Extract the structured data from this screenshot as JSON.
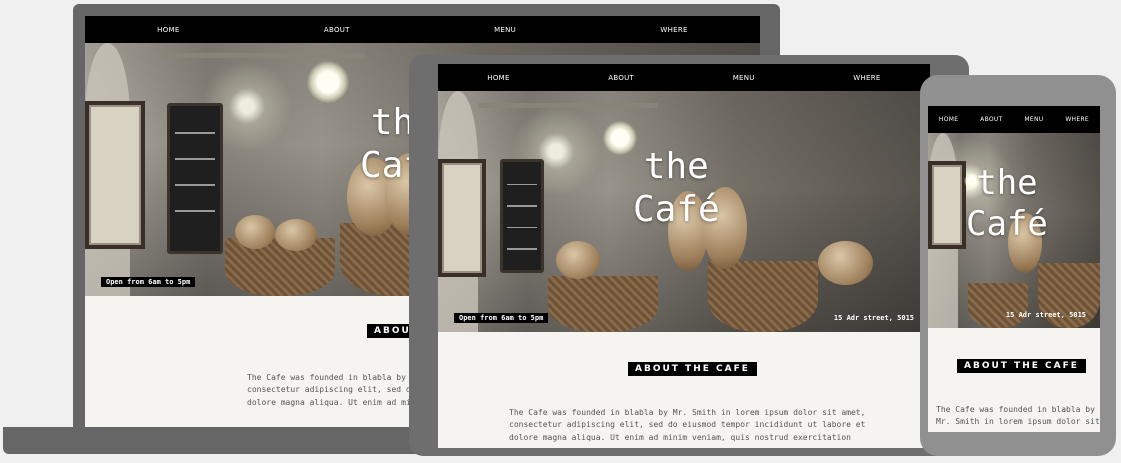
{
  "nav": {
    "home": "HOME",
    "about": "ABOUT",
    "menu": "MENU",
    "where": "WHERE"
  },
  "hero": {
    "title": "the\nCafé",
    "hours": "Open from 6am to 5pm",
    "address": "15 Adr street, 5015"
  },
  "about": {
    "heading": "ABOUT THE CAFE",
    "laptop_lines": [
      "The Cafe was founded in blabla by Mr",
      "consectetur adipiscing elit, sed do",
      "dolore magna aliqua. Ut enim ad minim"
    ],
    "tablet_lines": [
      "The Cafe was founded in blabla by Mr. Smith in lorem ipsum dolor sit amet,",
      "consectetur adipiscing elit, sed do eiusmod tempor incididunt ut labore et",
      "dolore magna aliqua. Ut enim ad minim veniam, quis nostrud exercitation"
    ],
    "phone_lines": [
      "The Cafe was founded in blabla by",
      "Mr. Smith in lorem ipsum dolor sit"
    ]
  }
}
